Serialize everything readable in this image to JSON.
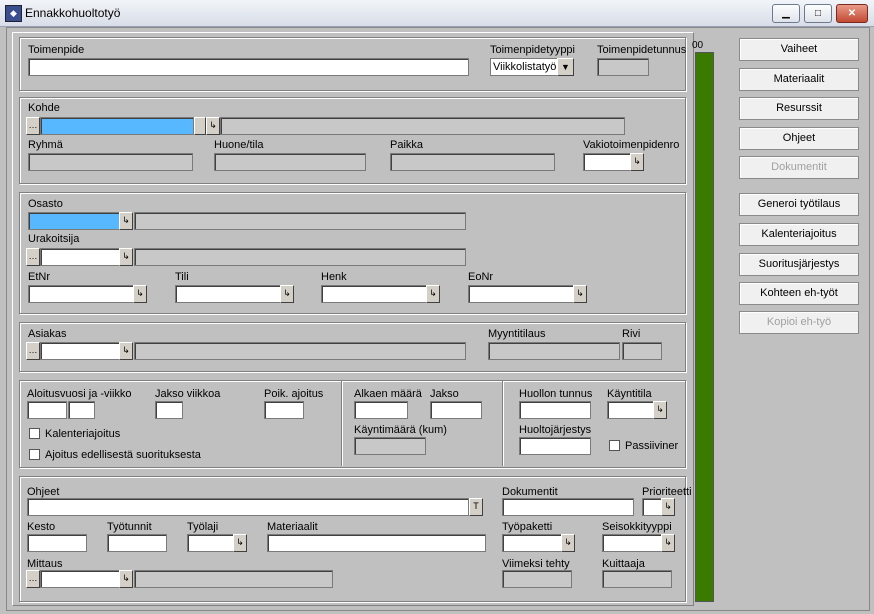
{
  "window": {
    "title": "Ennakkohuoltotyö",
    "minimize": "▁",
    "maximize": "□",
    "close": "✕"
  },
  "colors": {
    "progress": "#3a7a00",
    "highlight_field": "#58b8ff",
    "background": "#c0c0c0"
  },
  "progress": {
    "label": "00",
    "fill_fraction": 1.0
  },
  "toimenpide": {
    "label": "Toimenpide",
    "value": "",
    "tyyppi_label": "Toimenpidetyyppi",
    "tyyppi_value": "Viikkolistatyö",
    "tunnus_label": "Toimenpidetunnus",
    "tunnus_value": ""
  },
  "kohde": {
    "label": "Kohde",
    "ryhma_label": "Ryhmä",
    "huone_label": "Huone/tila",
    "paikka_label": "Paikka",
    "vakio_label": "Vakiotoimenpidenro"
  },
  "osasto": {
    "label": "Osasto",
    "urakoitsija_label": "Urakoitsija",
    "etnr_label": "EtNr",
    "tili_label": "Tili",
    "henk_label": "Henk",
    "eonr_label": "EoNr"
  },
  "asiakas": {
    "label": "Asiakas",
    "myyntitilaus_label": "Myyntitilaus",
    "rivi_label": "Rivi"
  },
  "ajoitus": {
    "aloitus_label": "Aloitusvuosi ja -viikko",
    "jakso_viikkoa_label": "Jakso viikkoa",
    "poik_label": "Poik. ajoitus",
    "kalenteri_label": "Kalenteriajoitus",
    "edellinen_label": "Ajoitus edellisestä suorituksesta",
    "alkaen_label": "Alkaen määrä",
    "jakso_label": "Jakso",
    "kayntimaara_label": "Käyntimäärä (kum)",
    "huollon_tunnus_label": "Huollon tunnus",
    "kayntitila_label": "Käyntitila",
    "huoltojarjestys_label": "Huoltojärjestys",
    "passiiviner_label": "Passiiviner"
  },
  "ohjeet": {
    "label": "Ohjeet",
    "t_button": "T",
    "dokumentit_label": "Dokumentit",
    "prioriteetti_label": "Prioriteetti",
    "kesto_label": "Kesto",
    "tyotunnit_label": "Työtunnit",
    "tyolaji_label": "Työlaji",
    "materiaalit_label": "Materiaalit",
    "tyopaketti_label": "Työpaketti",
    "seisokkityyppi_label": "Seisokkityyppi",
    "mittaus_label": "Mittaus",
    "viimeksi_label": "Viimeksi tehty",
    "kuittaaja_label": "Kuittaaja"
  },
  "side_buttons": [
    {
      "label": "Vaiheet",
      "enabled": true
    },
    {
      "label": "Materiaalit",
      "enabled": true
    },
    {
      "label": "Resurssit",
      "enabled": true
    },
    {
      "label": "Ohjeet",
      "enabled": true
    },
    {
      "label": "Dokumentit",
      "enabled": false
    },
    {
      "label": "Generoi työtilaus",
      "enabled": true
    },
    {
      "label": "Kalenteriajoitus",
      "enabled": true
    },
    {
      "label": "Suoritusjärjestys",
      "enabled": true
    },
    {
      "label": "Kohteen eh-työt",
      "enabled": true
    },
    {
      "label": "Kopioi eh-työ",
      "enabled": false
    }
  ],
  "icons": {
    "lookup": "…",
    "dropdown": "▼",
    "link": "↳"
  }
}
